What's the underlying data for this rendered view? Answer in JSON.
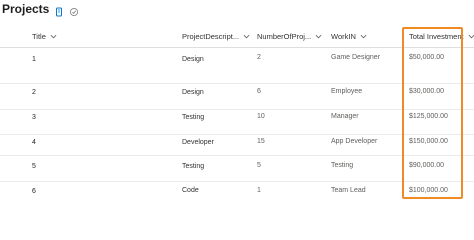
{
  "list_title": "Projects",
  "icons": {
    "info": "info-icon",
    "sync": "sync-icon",
    "sort": "chevron-down-icon"
  },
  "columns": [
    "Title",
    "ProjectDescript...",
    "NumberOfProj...",
    "WorkIN",
    "Total Investment"
  ],
  "rows": [
    {
      "title": "1",
      "description": "Design",
      "number": "2",
      "workin": "Game Designer",
      "investment": "$50,000.00"
    },
    {
      "title": "2",
      "description": "Design",
      "number": "6",
      "workin": "Employee",
      "investment": "$30,000.00"
    },
    {
      "title": "3",
      "description": "Testing",
      "number": "10",
      "workin": "Manager",
      "investment": "$125,000.00"
    },
    {
      "title": "4",
      "description": "Developer",
      "number": "15",
      "workin": "App Developer",
      "investment": "$150,000.00"
    },
    {
      "title": "5",
      "description": "Testing",
      "number": "5",
      "workin": "Testing",
      "investment": "$90,000.00"
    },
    {
      "title": "6",
      "description": "Code",
      "number": "1",
      "workin": "Team Lead",
      "investment": "$100,000.00"
    }
  ],
  "colors": {
    "highlight": "#f08a24",
    "accent": "#0078d4"
  }
}
